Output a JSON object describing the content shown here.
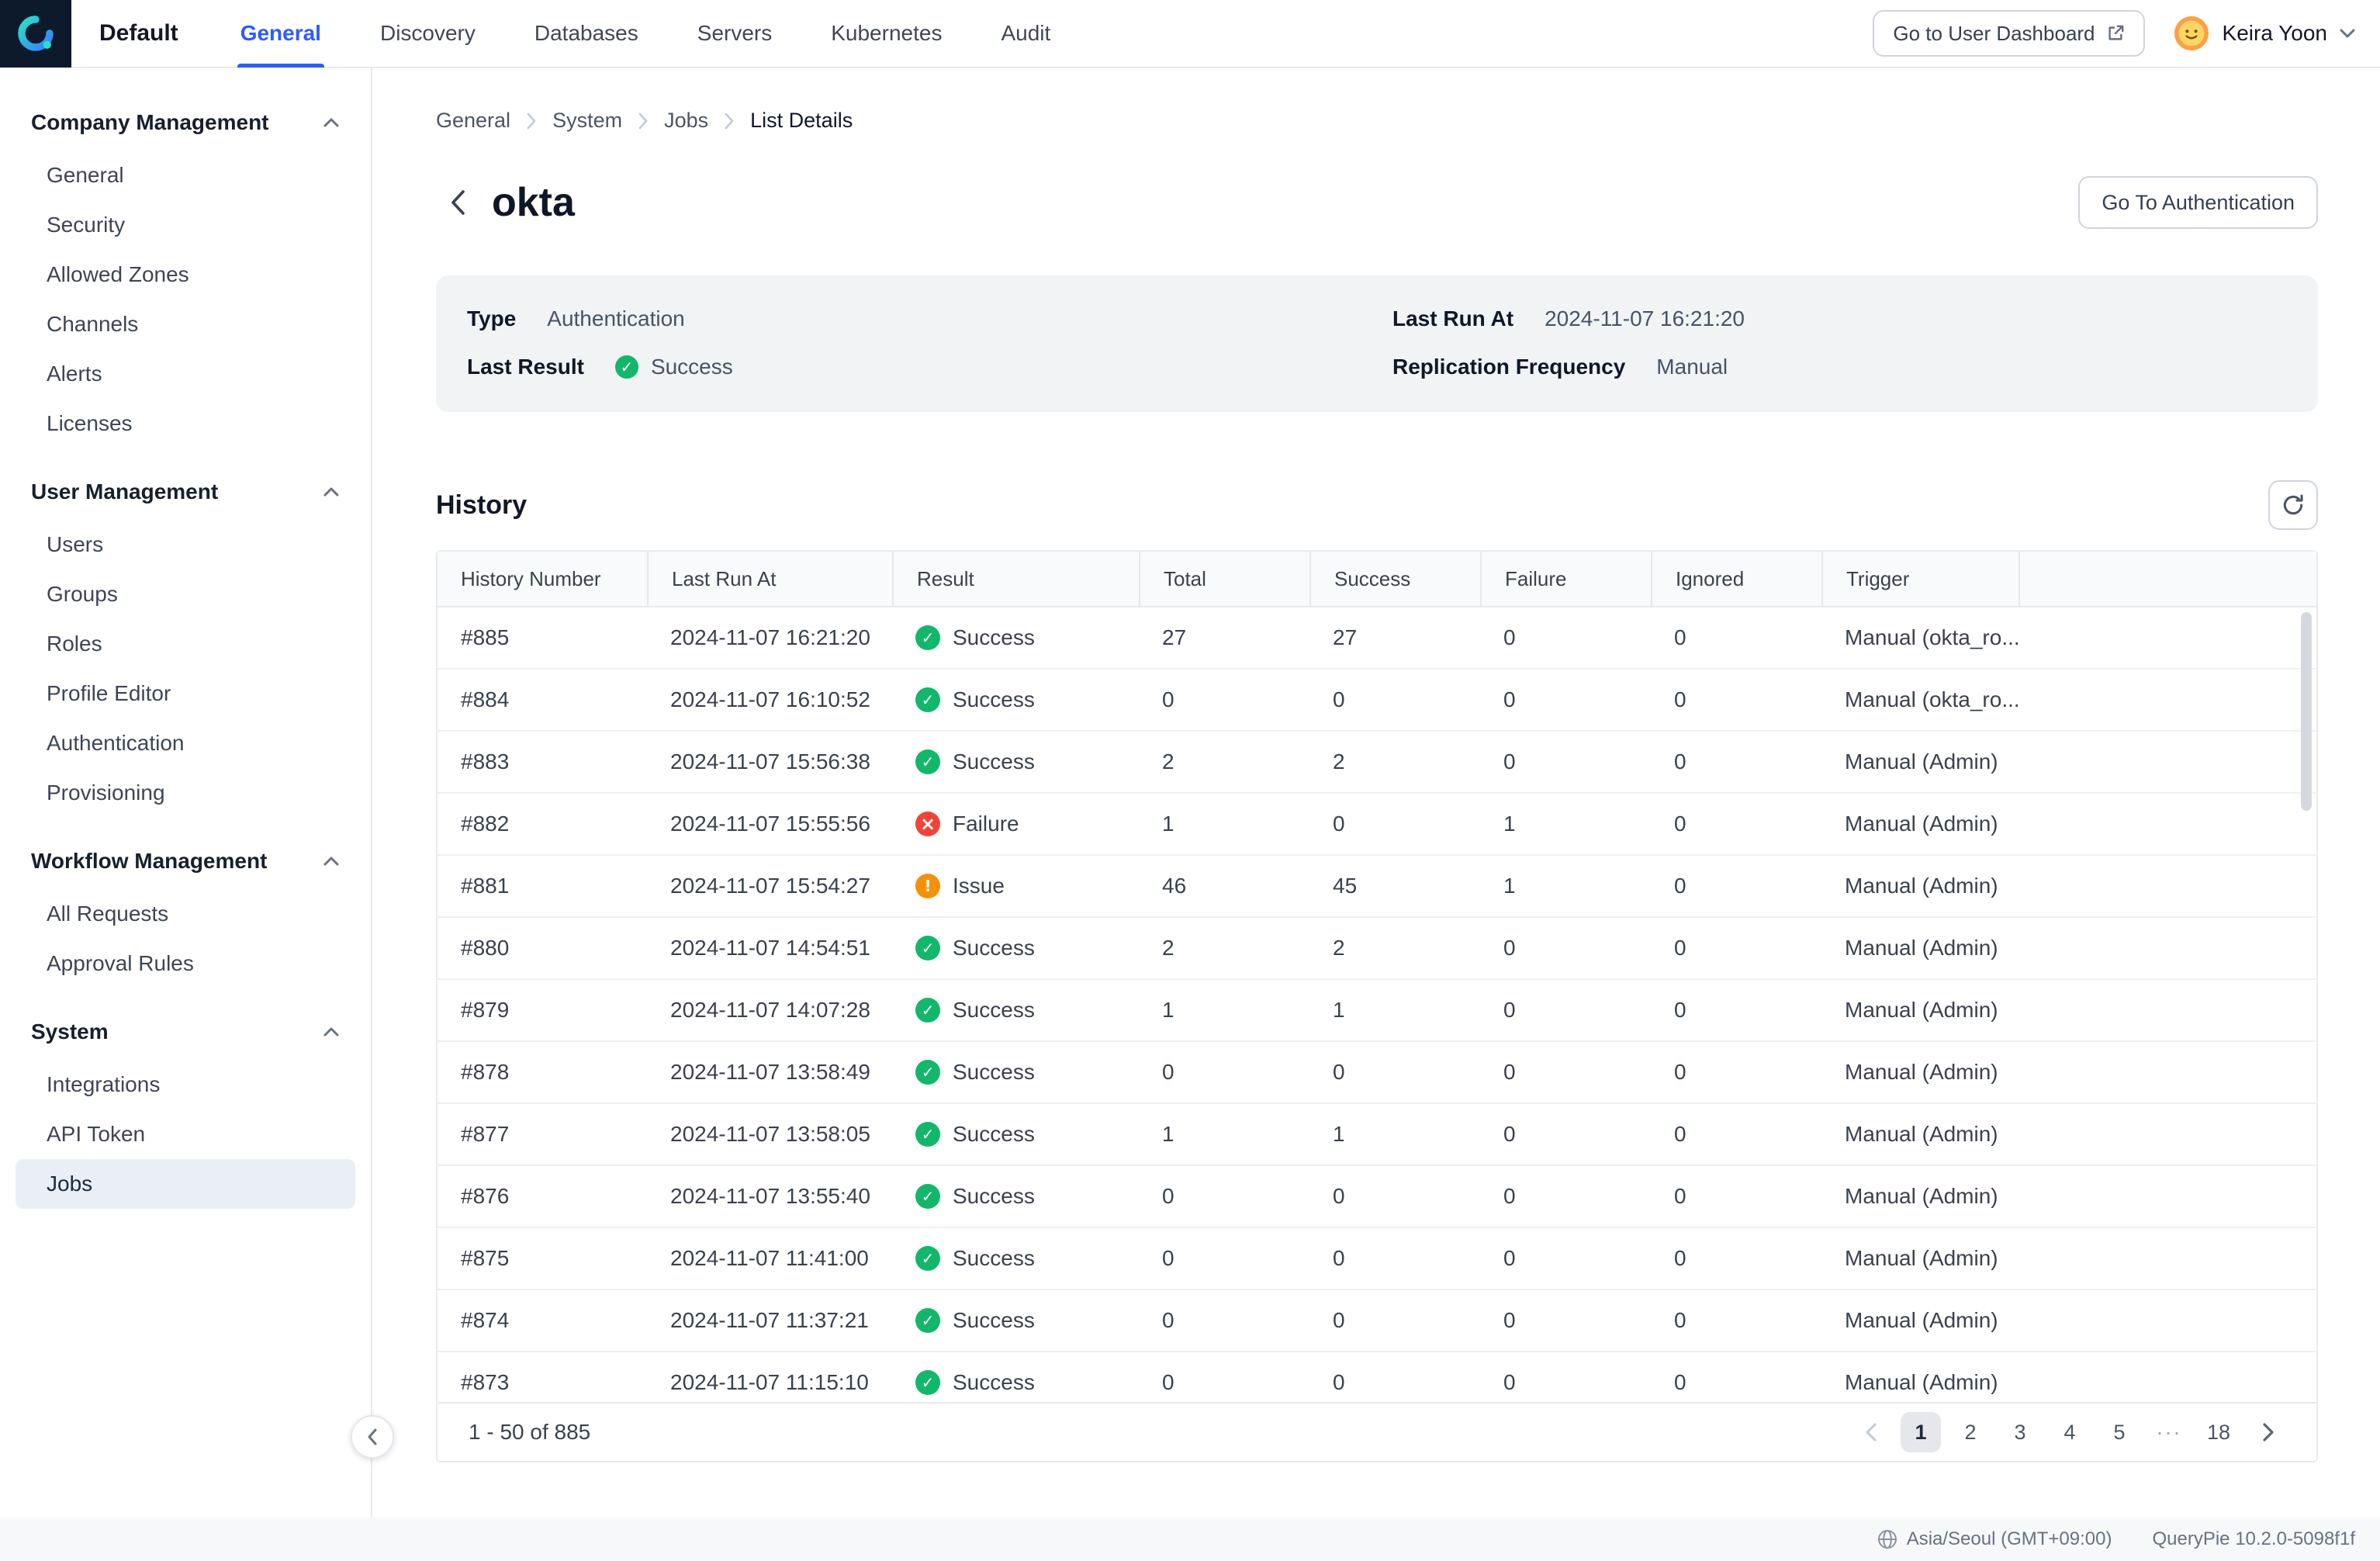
{
  "colors": {
    "accent": "#2e5bff",
    "success": "#12b76a",
    "failure": "#f04438",
    "warning": "#f79009",
    "active_nav_bg": "#e9eef7"
  },
  "icons": {
    "logo": "querypie-logo",
    "external_link": "external-link-icon",
    "chevron": "chevron-icon",
    "refresh": "refresh-icon",
    "globe": "globe-icon",
    "avatar": "smiley-avatar"
  },
  "topnav": {
    "workspace": "Default",
    "tabs": [
      "General",
      "Discovery",
      "Databases",
      "Servers",
      "Kubernetes",
      "Audit"
    ],
    "active_tab": "General",
    "dashboard_button": "Go to User Dashboard",
    "user_name": "Keira Yoon"
  },
  "sidebar": {
    "active_item": "Jobs",
    "sections": [
      {
        "title": "Company Management",
        "items": [
          "General",
          "Security",
          "Allowed Zones",
          "Channels",
          "Alerts",
          "Licenses"
        ]
      },
      {
        "title": "User Management",
        "items": [
          "Users",
          "Groups",
          "Roles",
          "Profile Editor",
          "Authentication",
          "Provisioning"
        ]
      },
      {
        "title": "Workflow Management",
        "items": [
          "All Requests",
          "Approval Rules"
        ]
      },
      {
        "title": "System",
        "items": [
          "Integrations",
          "API Token",
          "Jobs"
        ]
      }
    ]
  },
  "breadcrumb": [
    "General",
    "System",
    "Jobs",
    "List Details"
  ],
  "page": {
    "title": "okta",
    "auth_button": "Go To Authentication",
    "info": {
      "type_label": "Type",
      "type_value": "Authentication",
      "last_result_label": "Last Result",
      "last_result_value": "Success",
      "last_run_label": "Last Run At",
      "last_run_value": "2024-11-07 16:21:20",
      "replication_label": "Replication Frequency",
      "replication_value": "Manual"
    }
  },
  "history": {
    "title": "History",
    "columns": [
      "History Number",
      "Last Run At",
      "Result",
      "Total",
      "Success",
      "Failure",
      "Ignored",
      "Trigger"
    ],
    "rows": [
      {
        "history_number": "#885",
        "last_run_at": "2024-11-07 16:21:20",
        "result": "Success",
        "result_class": "status-dot status-success",
        "total": "27",
        "success": "27",
        "failure": "0",
        "ignored": "0",
        "trigger": "Manual (okta_ro..."
      },
      {
        "history_number": "#884",
        "last_run_at": "2024-11-07 16:10:52",
        "result": "Success",
        "result_class": "status-dot status-success",
        "total": "0",
        "success": "0",
        "failure": "0",
        "ignored": "0",
        "trigger": "Manual (okta_ro..."
      },
      {
        "history_number": "#883",
        "last_run_at": "2024-11-07 15:56:38",
        "result": "Success",
        "result_class": "status-dot status-success",
        "total": "2",
        "success": "2",
        "failure": "0",
        "ignored": "0",
        "trigger": "Manual (Admin)"
      },
      {
        "history_number": "#882",
        "last_run_at": "2024-11-07 15:55:56",
        "result": "Failure",
        "result_class": "status-dot status-failure",
        "total": "1",
        "success": "0",
        "failure": "1",
        "ignored": "0",
        "trigger": "Manual (Admin)"
      },
      {
        "history_number": "#881",
        "last_run_at": "2024-11-07 15:54:27",
        "result": "Issue",
        "result_class": "status-dot status-issue",
        "total": "46",
        "success": "45",
        "failure": "1",
        "ignored": "0",
        "trigger": "Manual (Admin)"
      },
      {
        "history_number": "#880",
        "last_run_at": "2024-11-07 14:54:51",
        "result": "Success",
        "result_class": "status-dot status-success",
        "total": "2",
        "success": "2",
        "failure": "0",
        "ignored": "0",
        "trigger": "Manual (Admin)"
      },
      {
        "history_number": "#879",
        "last_run_at": "2024-11-07 14:07:28",
        "result": "Success",
        "result_class": "status-dot status-success",
        "total": "1",
        "success": "1",
        "failure": "0",
        "ignored": "0",
        "trigger": "Manual (Admin)"
      },
      {
        "history_number": "#878",
        "last_run_at": "2024-11-07 13:58:49",
        "result": "Success",
        "result_class": "status-dot status-success",
        "total": "0",
        "success": "0",
        "failure": "0",
        "ignored": "0",
        "trigger": "Manual (Admin)"
      },
      {
        "history_number": "#877",
        "last_run_at": "2024-11-07 13:58:05",
        "result": "Success",
        "result_class": "status-dot status-success",
        "total": "1",
        "success": "1",
        "failure": "0",
        "ignored": "0",
        "trigger": "Manual (Admin)"
      },
      {
        "history_number": "#876",
        "last_run_at": "2024-11-07 13:55:40",
        "result": "Success",
        "result_class": "status-dot status-success",
        "total": "0",
        "success": "0",
        "failure": "0",
        "ignored": "0",
        "trigger": "Manual (Admin)"
      },
      {
        "history_number": "#875",
        "last_run_at": "2024-11-07 11:41:00",
        "result": "Success",
        "result_class": "status-dot status-success",
        "total": "0",
        "success": "0",
        "failure": "0",
        "ignored": "0",
        "trigger": "Manual (Admin)"
      },
      {
        "history_number": "#874",
        "last_run_at": "2024-11-07 11:37:21",
        "result": "Success",
        "result_class": "status-dot status-success",
        "total": "0",
        "success": "0",
        "failure": "0",
        "ignored": "0",
        "trigger": "Manual (Admin)"
      },
      {
        "history_number": "#873",
        "last_run_at": "2024-11-07 11:15:10",
        "result": "Success",
        "result_class": "status-dot status-success",
        "total": "0",
        "success": "0",
        "failure": "0",
        "ignored": "0",
        "trigger": "Manual (Admin)"
      }
    ],
    "summary": "1 - 50 of 885",
    "pages": [
      "1",
      "2",
      "3",
      "4",
      "5",
      "···",
      "18"
    ],
    "active_page": "1"
  },
  "footer": {
    "timezone": "Asia/Seoul (GMT+09:00)",
    "version": "QueryPie 10.2.0-5098f1f"
  }
}
